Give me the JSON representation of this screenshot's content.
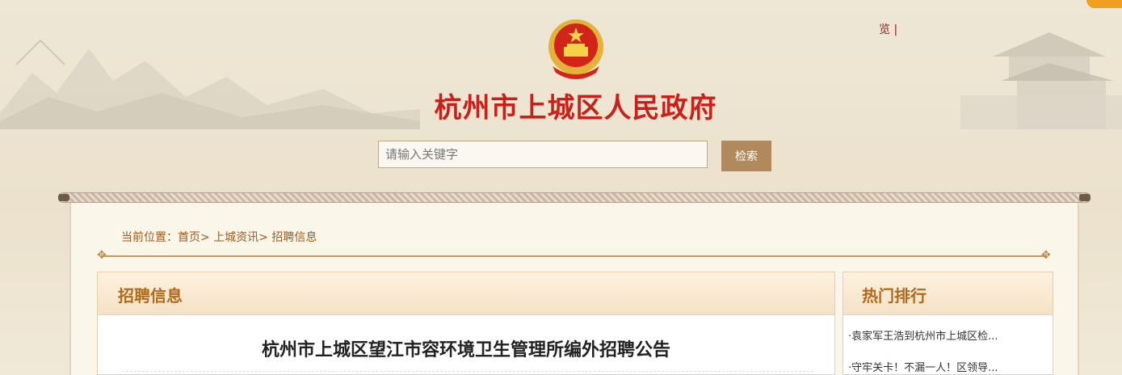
{
  "header": {
    "top_link": "览 |",
    "site_title": "杭州市上城区人民政府"
  },
  "search": {
    "placeholder": "请输入关键字",
    "button_label": "检索"
  },
  "breadcrumb": {
    "prefix": "当前位置：",
    "items": [
      "首页",
      "上城资讯",
      "招聘信息"
    ],
    "separator": ">"
  },
  "main": {
    "section_title": "招聘信息",
    "article_title": "杭州市上城区望江市容环境卫生管理所编外招聘公告"
  },
  "sidebar": {
    "title": "热门排行",
    "items": [
      "·袁家军王浩到杭州市上城区检...",
      "·守牢关卡！不漏一人！区领导..."
    ]
  },
  "colors": {
    "title_red": "#c8201a",
    "accent_brown": "#b08a5c",
    "breadcrumb_brown": "#9a5b1d",
    "section_title": "#b06a1c"
  }
}
